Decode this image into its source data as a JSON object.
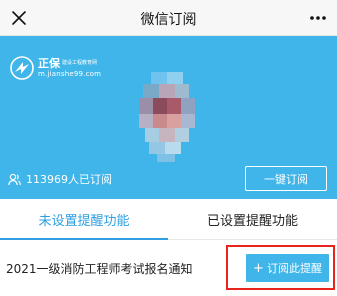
{
  "topbar": {
    "title": "微信订阅",
    "close_icon": "close-icon",
    "more_icon": "more-dots-icon"
  },
  "banner": {
    "background_color": "#3fb5ea",
    "logo": {
      "brand": "正保",
      "brand_sub": "建设工程教育网",
      "url": "m.jianshe99.com"
    },
    "subscriber_count": "113969人已订阅",
    "subscribe_all_label": "一键订阅"
  },
  "tabs": [
    {
      "label": "未设置提醒功能",
      "active": true
    },
    {
      "label": "已设置提醒功能",
      "active": false
    }
  ],
  "notice": {
    "title": "2021一级消防工程师考试报名通知",
    "button_icon": "+",
    "button_label": "订阅此提醒",
    "highlight_color": "#e8241c"
  },
  "colors": {
    "accent": "#3fb5ea",
    "tab_active": "#2f9fe0"
  }
}
